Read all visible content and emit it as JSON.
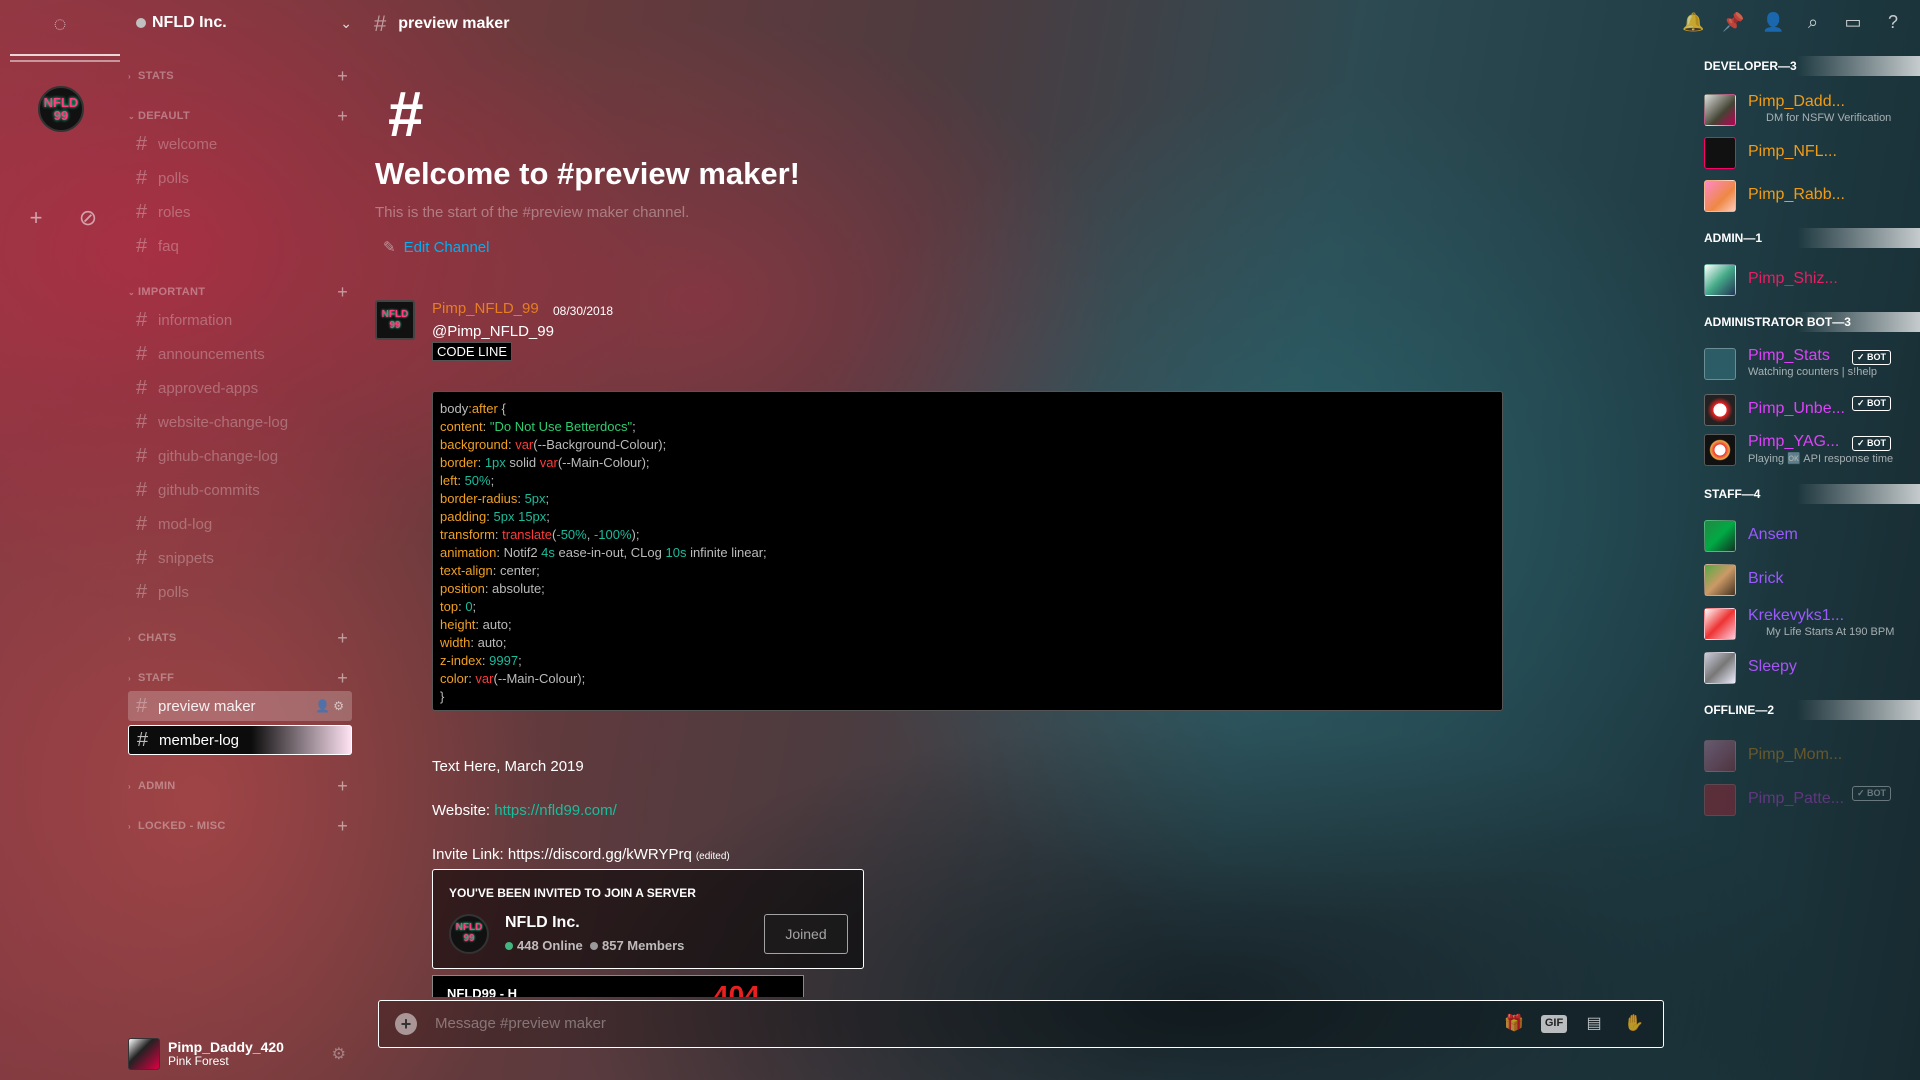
{
  "server": {
    "name": "NFLD Inc.",
    "logo_text_top": "NFLD",
    "logo_text_bottom": "99"
  },
  "categories": {
    "stats": "STATS",
    "default": "DEFAULT",
    "important": "IMPORTANT",
    "chats": "CHATS",
    "staff": "STAFF",
    "admin": "ADMIN",
    "locked_misc": "LOCKED - MISC"
  },
  "channels": {
    "default": [
      "welcome",
      "polls",
      "roles",
      "faq"
    ],
    "important": [
      "information",
      "announcements",
      "approved-apps",
      "website-change-log",
      "github-change-log",
      "github-commits",
      "mod-log",
      "snippets",
      "polls"
    ],
    "staff": [
      "preview maker",
      "member-log"
    ]
  },
  "user_panel": {
    "username": "Pimp_Daddy_420",
    "status": "Pink Forest"
  },
  "chat": {
    "channel_name": "preview maker",
    "welcome_hash": "#",
    "welcome_title": "Welcome to #preview maker!",
    "welcome_sub": "This is the start of the #preview maker channel.",
    "edit_channel": "Edit Channel",
    "message": {
      "author": "Pimp_NFLD_99",
      "timestamp": "08/30/2018",
      "mention": "@Pimp_NFLD_99",
      "inline_code": "CODE LINE"
    },
    "text_lines": {
      "text_here": "Text Here, March 2019",
      "website_label": "Website: ",
      "website_url": "https://nfld99.com/",
      "invite_label": "Invite Link: https://discord.gg/kWRYPrq",
      "edited": "(edited)"
    },
    "invite": {
      "header": "YOU'VE BEEN INVITED TO JOIN A SERVER",
      "name": "NFLD Inc.",
      "online": "448 Online",
      "members": "857 Members",
      "button": "Joined"
    },
    "embed_peek": {
      "title": "NFLD99 - H",
      "number": "404"
    },
    "composer_placeholder": "Message #preview maker"
  },
  "members": {
    "developer_header": "DEVELOPER—3",
    "admin_header": "ADMIN—1",
    "bot_header": "ADMINISTRATOR BOT—3",
    "staff_header": "STAFF—4",
    "offline_header": "OFFLINE—2",
    "bot_tag": "✓ BOT",
    "developer": [
      {
        "name": "Pimp_Dadd...",
        "sub": "DM for NSFW Verification"
      },
      {
        "name": "Pimp_NFL..."
      },
      {
        "name": "Pimp_Rabb..."
      }
    ],
    "admin": [
      {
        "name": "Pimp_Shiz..."
      }
    ],
    "bots": [
      {
        "name": "Pimp_Stats",
        "sub": "Watching counters | s!help"
      },
      {
        "name": "Pimp_Unbe..."
      },
      {
        "name": "Pimp_YAG...",
        "sub": "Playing 🆗 API response time"
      }
    ],
    "staff": [
      {
        "name": "Ansem"
      },
      {
        "name": "Brick"
      },
      {
        "name": "Krekevyks1...",
        "sub": "My Life Starts At 190 BPM"
      },
      {
        "name": "Sleepy"
      }
    ],
    "offline": [
      {
        "name": "Pimp_Mom..."
      },
      {
        "name": "Pimp_Patte..."
      }
    ]
  },
  "colors": {
    "developer": "#f39c12",
    "admin": "#e91e63",
    "bot": "#e040fb",
    "staff": "#9b59ff",
    "link": "#1abc9c",
    "online": "#43b581"
  }
}
